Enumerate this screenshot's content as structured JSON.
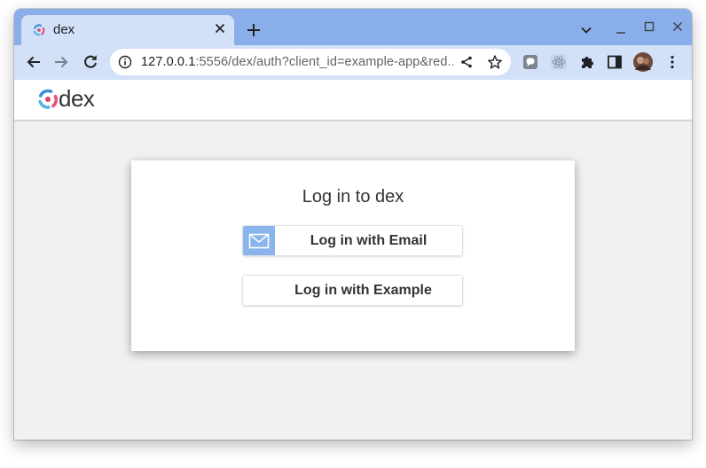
{
  "browser": {
    "tab": {
      "title": "dex"
    },
    "omnibox": {
      "url_host": "127.0.0.1",
      "url_rest": ":5556/dex/auth?client_id=example-app&red..."
    }
  },
  "page": {
    "logo_text": "dex",
    "heading": "Log in to dex",
    "buttons": {
      "email": "Log in with Email",
      "example": "Log in with Example"
    }
  },
  "colors": {
    "tabstrip": "#8aaeea",
    "toolbar": "#d2e1f8",
    "email_icon_bg": "#89b4ec",
    "page_bg": "#f1f1f1"
  },
  "icons": [
    "dex-favicon-icon",
    "close-icon",
    "plus-icon",
    "chevron-down-icon",
    "minimize-icon",
    "maximize-icon",
    "window-close-icon",
    "back-arrow-icon",
    "forward-arrow-icon",
    "reload-icon",
    "info-icon",
    "share-icon",
    "star-icon",
    "extension-chat-icon",
    "react-extension-icon",
    "puzzle-icon",
    "side-panel-icon",
    "avatar",
    "kebab-menu-icon",
    "envelope-icon"
  ]
}
